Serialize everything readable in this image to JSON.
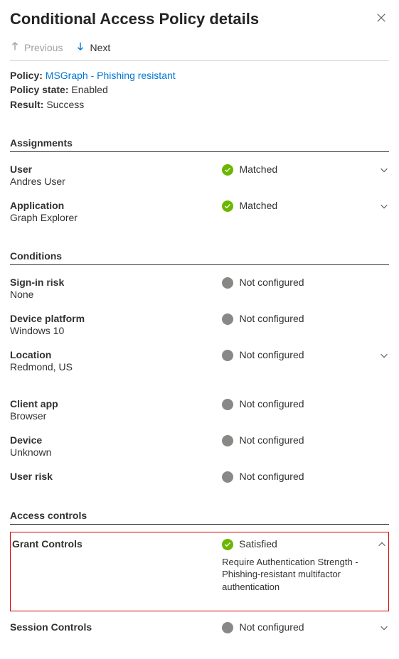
{
  "header": {
    "title": "Conditional Access Policy details"
  },
  "nav": {
    "previous": "Previous",
    "next": "Next"
  },
  "meta": {
    "policy_label": "Policy:",
    "policy_value": "MSGraph - Phishing resistant",
    "state_label": "Policy state:",
    "state_value": "Enabled",
    "result_label": "Result:",
    "result_value": "Success"
  },
  "sections": {
    "assignments": {
      "heading": "Assignments",
      "user": {
        "title": "User",
        "value": "Andres User",
        "status": "Matched"
      },
      "application": {
        "title": "Application",
        "value": "Graph Explorer",
        "status": "Matched"
      }
    },
    "conditions": {
      "heading": "Conditions",
      "signin_risk": {
        "title": "Sign-in risk",
        "value": "None",
        "status": "Not configured"
      },
      "device_platform": {
        "title": "Device platform",
        "value": "Windows 10",
        "status": "Not configured"
      },
      "location": {
        "title": "Location",
        "value": "Redmond, US",
        "status": "Not configured"
      },
      "client_app": {
        "title": "Client app",
        "value": "Browser",
        "status": "Not configured"
      },
      "device": {
        "title": "Device",
        "value": "Unknown",
        "status": "Not configured"
      },
      "user_risk": {
        "title": "User risk",
        "value": "",
        "status": "Not configured"
      }
    },
    "access_controls": {
      "heading": "Access controls",
      "grant": {
        "title": "Grant Controls",
        "status": "Satisfied",
        "detail": "Require Authentication Strength - Phishing-resistant multifactor authentication"
      },
      "session": {
        "title": "Session Controls",
        "status": "Not configured"
      }
    }
  }
}
